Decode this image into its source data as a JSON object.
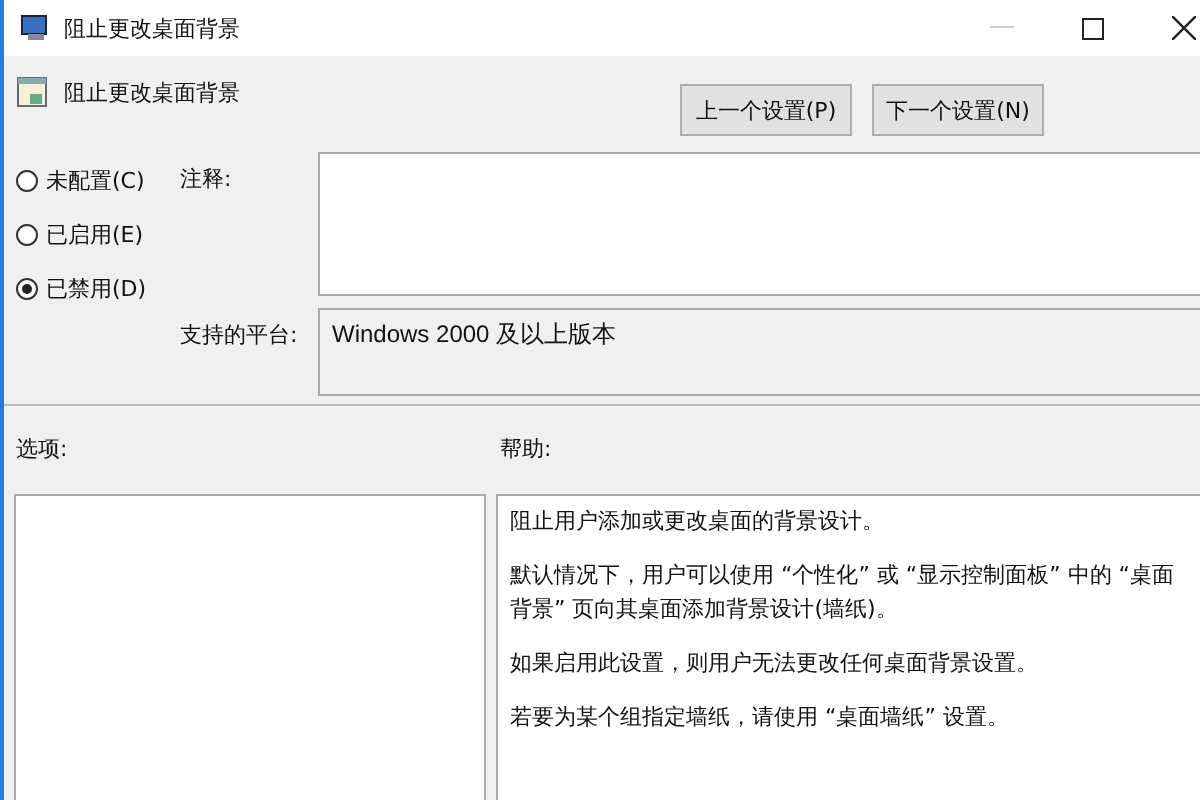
{
  "window": {
    "title": "阻止更改桌面背景"
  },
  "policy": {
    "name": "阻止更改桌面背景"
  },
  "nav_buttons": [
    {
      "label": "上一个设置(P)"
    },
    {
      "label": "下一个设置(N)"
    }
  ],
  "state_options": [
    {
      "label": "未配置(C)",
      "selected": false
    },
    {
      "label": "已启用(E)",
      "selected": false
    },
    {
      "label": "已禁用(D)",
      "selected": true
    }
  ],
  "comment": {
    "label": "注释:"
  },
  "platform": {
    "label": "支持的平台:",
    "value": "Windows 2000 及以上版本"
  },
  "options": {
    "label": "选项:"
  },
  "help": {
    "label": "帮助:",
    "paragraphs": [
      "阻止用户添加或更改桌面的背景设计。",
      "默认情况下，用户可以使用 “个性化” 或 “显示控制面板” 中的 “桌面背景” 页向其桌面添加背景设计(墙纸)。",
      "如果启用此设置，则用户无法更改任何桌面背景设置。",
      "若要为某个组指定墙纸，请使用 “桌面墙纸” 设置。"
    ]
  }
}
